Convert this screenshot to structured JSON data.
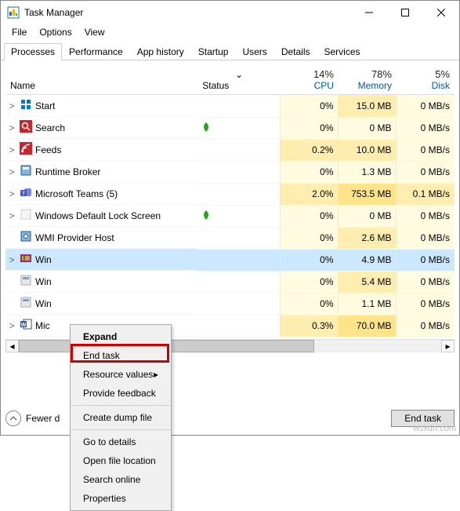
{
  "window": {
    "title": "Task Manager"
  },
  "menu": {
    "file": "File",
    "options": "Options",
    "view": "View"
  },
  "tabs": [
    "Processes",
    "Performance",
    "App history",
    "Startup",
    "Users",
    "Details",
    "Services"
  ],
  "headers": {
    "name": "Name",
    "status": "Status",
    "cpu_pct": "14%",
    "cpu_lbl": "CPU",
    "mem_pct": "78%",
    "mem_lbl": "Memory",
    "disk_pct": "5%",
    "disk_lbl": "Disk"
  },
  "rows": [
    {
      "exp": ">",
      "name": "Start",
      "icon": "start",
      "status": "",
      "cpu": "0%",
      "mem": "15.0 MB",
      "disk": "0 MB/s",
      "cpuCls": "",
      "memCls": "h1",
      "diskCls": ""
    },
    {
      "exp": ">",
      "name": "Search",
      "icon": "search",
      "status": "leaf",
      "cpu": "0%",
      "mem": "0 MB",
      "disk": "0 MB/s",
      "cpuCls": "",
      "memCls": "",
      "diskCls": ""
    },
    {
      "exp": ">",
      "name": "Feeds",
      "icon": "feeds",
      "status": "",
      "cpu": "0.2%",
      "mem": "10.0 MB",
      "disk": "0 MB/s",
      "cpuCls": "h1",
      "memCls": "h1",
      "diskCls": ""
    },
    {
      "exp": ">",
      "name": "Runtime Broker",
      "icon": "runtime",
      "status": "",
      "cpu": "0%",
      "mem": "1.3 MB",
      "disk": "0 MB/s",
      "cpuCls": "",
      "memCls": "",
      "diskCls": ""
    },
    {
      "exp": ">",
      "name": "Microsoft Teams (5)",
      "icon": "teams",
      "status": "",
      "cpu": "2.0%",
      "mem": "753.5 MB",
      "disk": "0.1 MB/s",
      "cpuCls": "h1",
      "memCls": "h2",
      "diskCls": "h1"
    },
    {
      "exp": ">",
      "name": "Windows Default Lock Screen",
      "icon": "lock",
      "status": "leaf",
      "cpu": "0%",
      "mem": "0 MB",
      "disk": "0 MB/s",
      "cpuCls": "",
      "memCls": "",
      "diskCls": ""
    },
    {
      "exp": "",
      "name": "WMI Provider Host",
      "icon": "wmi",
      "status": "",
      "cpu": "0%",
      "mem": "2.6 MB",
      "disk": "0 MB/s",
      "cpuCls": "",
      "memCls": "h1",
      "diskCls": ""
    },
    {
      "exp": ">",
      "name": "Win",
      "icon": "winrar",
      "status": "",
      "cpu": "0%",
      "mem": "4.9 MB",
      "disk": "0 MB/s",
      "cpuCls": "",
      "memCls": "h1",
      "diskCls": "",
      "selected": true
    },
    {
      "exp": "",
      "name": "Win",
      "icon": "generic",
      "status": "",
      "cpu": "0%",
      "mem": "5.4 MB",
      "disk": "0 MB/s",
      "cpuCls": "",
      "memCls": "h1",
      "diskCls": ""
    },
    {
      "exp": "",
      "name": "Win",
      "icon": "generic",
      "status": "",
      "cpu": "0%",
      "mem": "1.1 MB",
      "disk": "0 MB/s",
      "cpuCls": "",
      "memCls": "",
      "diskCls": ""
    },
    {
      "exp": ">",
      "name": "Mic",
      "icon": "word",
      "status": "",
      "cpu": "0.3%",
      "mem": "70.0 MB",
      "disk": "0 MB/s",
      "cpuCls": "h1",
      "memCls": "h2",
      "diskCls": ""
    }
  ],
  "context_menu": {
    "expand": "Expand",
    "end_task": "End task",
    "resource_values": "Resource values",
    "provide_feedback": "Provide feedback",
    "create_dump": "Create dump file",
    "go_to_details": "Go to details",
    "open_file_location": "Open file location",
    "search_online": "Search online",
    "properties": "Properties"
  },
  "footer": {
    "fewer": "Fewer d",
    "end_task": "End task"
  },
  "watermark": "wsxdn.com"
}
